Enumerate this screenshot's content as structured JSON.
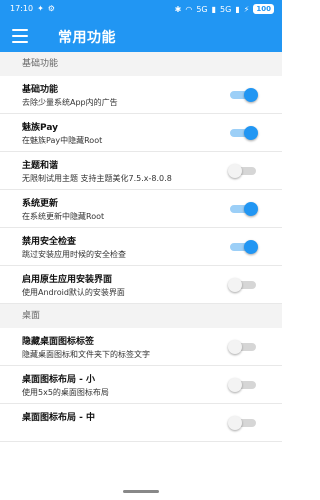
{
  "status": {
    "time": "17:10",
    "signal1": "5G",
    "signal2": "5G",
    "battery": "100"
  },
  "appbar": {
    "title": "常用功能"
  },
  "sections": [
    {
      "label": "基础功能"
    },
    {
      "label": "桌面"
    }
  ],
  "items": [
    {
      "title": "基础功能",
      "subtitle": "去除少量系统App内的广告",
      "on": true
    },
    {
      "title": "魅族Pay",
      "subtitle": "在魅族Pay中隐藏Root",
      "on": true
    },
    {
      "title": "主题和谐",
      "subtitle": "无限制试用主题 支持主题美化7.5.x-8.0.8",
      "on": false
    },
    {
      "title": "系统更新",
      "subtitle": "在系统更新中隐藏Root",
      "on": true
    },
    {
      "title": "禁用安全检查",
      "subtitle": "跳过安装应用时候的安全检查",
      "on": true
    },
    {
      "title": "启用原生应用安装界面",
      "subtitle": "使用Android默认的安装界面",
      "on": false
    },
    {
      "title": "隐藏桌面图标标签",
      "subtitle": "隐藏桌面图标和文件夹下的标签文字",
      "on": false
    },
    {
      "title": "桌面图标布局 - 小",
      "subtitle": "使用5x5的桌面图标布局",
      "on": false
    },
    {
      "title": "桌面图标布局 - 中",
      "subtitle": "",
      "on": false
    }
  ],
  "colors": {
    "accent": "#2196f3"
  }
}
